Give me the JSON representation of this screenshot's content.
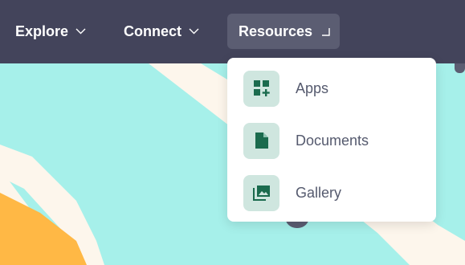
{
  "nav": {
    "items": [
      {
        "label": "Explore"
      },
      {
        "label": "Connect"
      },
      {
        "label": "Resources"
      }
    ]
  },
  "dropdown": {
    "items": [
      {
        "label": "Apps",
        "icon": "apps-add-icon"
      },
      {
        "label": "Documents",
        "icon": "document-icon"
      },
      {
        "label": "Gallery",
        "icon": "gallery-icon"
      }
    ]
  },
  "colors": {
    "navbar": "#43445b",
    "active_tab": "#5b5d72",
    "teal_band": "#a6f0ea",
    "cream": "#fdf6ec",
    "orange": "#ffb845",
    "icon_bg": "#cfe6df",
    "icon_fg": "#1b6b4e"
  }
}
